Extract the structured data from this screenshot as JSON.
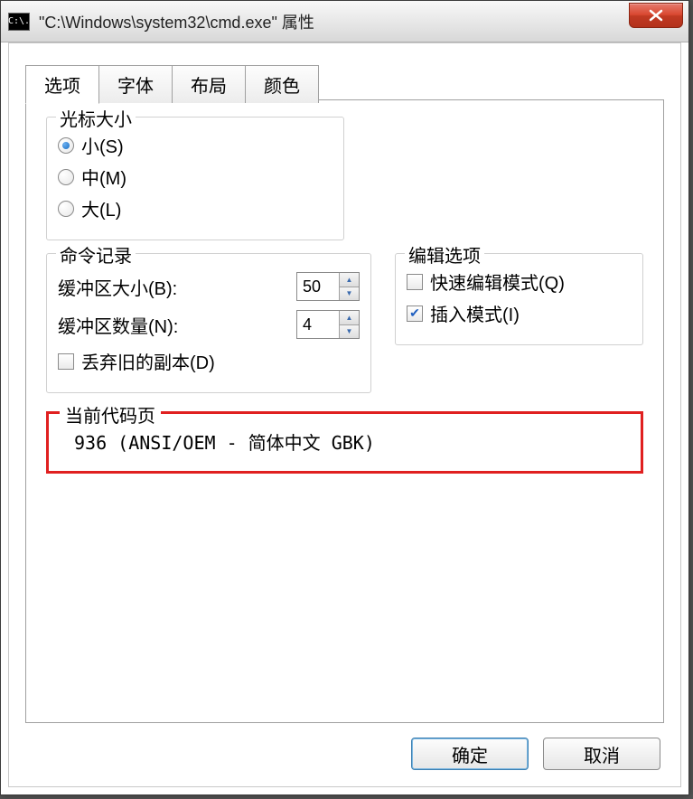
{
  "titlebar": {
    "icon_text": "C:\\.",
    "title": "\"C:\\Windows\\system32\\cmd.exe\" 属性"
  },
  "tabs": [
    {
      "label": "选项",
      "active": true
    },
    {
      "label": "字体",
      "active": false
    },
    {
      "label": "布局",
      "active": false
    },
    {
      "label": "颜色",
      "active": false
    }
  ],
  "cursor_size": {
    "legend": "光标大小",
    "options": [
      {
        "label": "小(S)",
        "selected": true
      },
      {
        "label": "中(M)",
        "selected": false
      },
      {
        "label": "大(L)",
        "selected": false
      }
    ]
  },
  "command_history": {
    "legend": "命令记录",
    "buffer_size_label": "缓冲区大小(B):",
    "buffer_size_value": "50",
    "buffer_count_label": "缓冲区数量(N):",
    "buffer_count_value": "4",
    "discard_old_label": "丢弃旧的副本(D)",
    "discard_old_checked": false
  },
  "edit_options": {
    "legend": "编辑选项",
    "quick_edit_label": "快速编辑模式(Q)",
    "quick_edit_checked": false,
    "insert_mode_label": "插入模式(I)",
    "insert_mode_checked": true
  },
  "codepage": {
    "legend": "当前代码页",
    "value": "936   (ANSI/OEM - 简体中文 GBK)"
  },
  "buttons": {
    "ok": "确定",
    "cancel": "取消"
  }
}
